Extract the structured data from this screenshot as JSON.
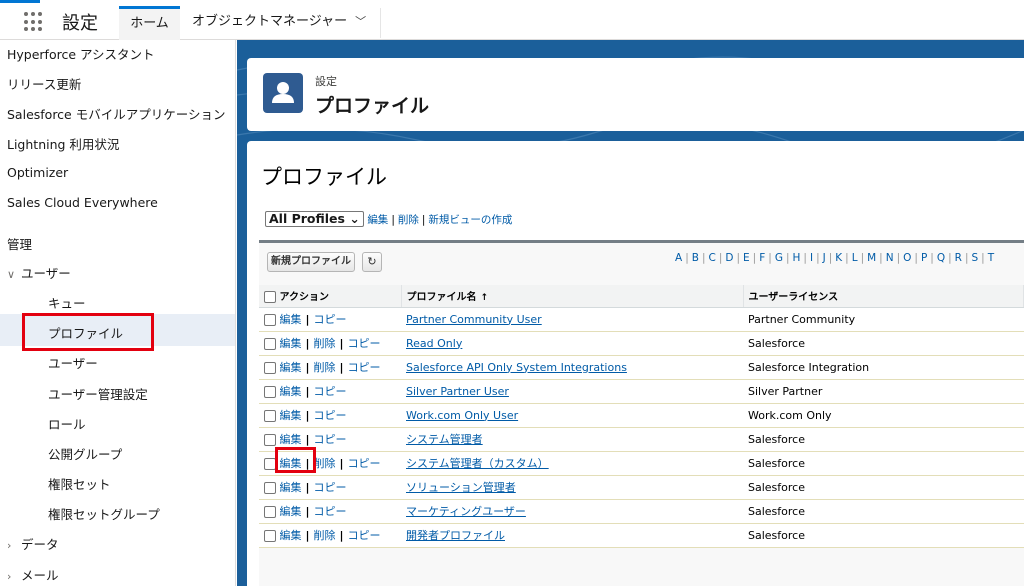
{
  "header": {
    "app_name": "設定",
    "tabs": [
      {
        "label": "ホーム"
      },
      {
        "label": "オブジェクトマネージャー"
      }
    ]
  },
  "colors": {
    "brand": "#0176d3",
    "header_band": "#1b5f9a",
    "link": "#015ba7",
    "highlight_box": "#e3000f"
  },
  "icons": {
    "app_launcher": "waffle-icon",
    "profile": "user-icon",
    "refresh": "refresh-icon",
    "expand": "chevron-down-icon",
    "collapse": "chevron-right-icon"
  },
  "sidebar": {
    "items": [
      {
        "label": "Hyperforce アシスタント"
      },
      {
        "label": "リリース更新"
      },
      {
        "label": "Salesforce モバイルアプリケーション"
      },
      {
        "label": "Lightning 利用状況"
      },
      {
        "label": "Optimizer"
      },
      {
        "label": "Sales Cloud Everywhere"
      }
    ],
    "section_label": "管理",
    "users_group": {
      "label": "ユーザー",
      "children": [
        {
          "label": "キュー"
        },
        {
          "label": "プロファイル"
        },
        {
          "label": "ユーザー"
        },
        {
          "label": "ユーザー管理設定"
        },
        {
          "label": "ロール"
        },
        {
          "label": "公開グループ"
        },
        {
          "label": "権限セット"
        },
        {
          "label": "権限セットグループ"
        }
      ]
    },
    "collapsed_groups": [
      {
        "label": "データ"
      },
      {
        "label": "メール"
      }
    ]
  },
  "page_header": {
    "eyebrow": "設定",
    "title": "プロファイル"
  },
  "content": {
    "title": "プロファイル",
    "view_select": "All Profiles",
    "view_links": [
      "編集",
      "削除",
      "新規ビューの作成"
    ],
    "new_button": "新規プロファイル",
    "alphabet": [
      "A",
      "B",
      "C",
      "D",
      "E",
      "F",
      "G",
      "H",
      "I",
      "J",
      "K",
      "L",
      "M",
      "N",
      "O",
      "P",
      "Q",
      "R",
      "S",
      "T"
    ],
    "columns": {
      "action": "アクション",
      "name": "プロファイル名",
      "name_sort": "↑",
      "license": "ユーザーライセンス"
    },
    "rows": [
      {
        "actions": [
          "編集",
          "コピー"
        ],
        "name": "Partner Community User",
        "license": "Partner Community"
      },
      {
        "actions": [
          "編集",
          "削除",
          "コピー"
        ],
        "name": "Read Only",
        "license": "Salesforce"
      },
      {
        "actions": [
          "編集",
          "削除",
          "コピー"
        ],
        "name": "Salesforce API Only System Integrations",
        "license": "Salesforce Integration"
      },
      {
        "actions": [
          "編集",
          "コピー"
        ],
        "name": "Silver Partner User",
        "license": "Silver Partner"
      },
      {
        "actions": [
          "編集",
          "コピー"
        ],
        "name": "Work.com Only User",
        "license": "Work.com Only"
      },
      {
        "actions": [
          "編集",
          "コピー"
        ],
        "name": "システム管理者",
        "license": "Salesforce"
      },
      {
        "actions": [
          "編集",
          "削除",
          "コピー"
        ],
        "name": "システム管理者（カスタム）",
        "license": "Salesforce"
      },
      {
        "actions": [
          "編集",
          "コピー"
        ],
        "name": "ソリューション管理者",
        "license": "Salesforce"
      },
      {
        "actions": [
          "編集",
          "コピー"
        ],
        "name": "マーケティングユーザー",
        "license": "Salesforce"
      },
      {
        "actions": [
          "編集",
          "削除",
          "コピー"
        ],
        "name": "開発者プロファイル",
        "license": "Salesforce"
      }
    ]
  }
}
